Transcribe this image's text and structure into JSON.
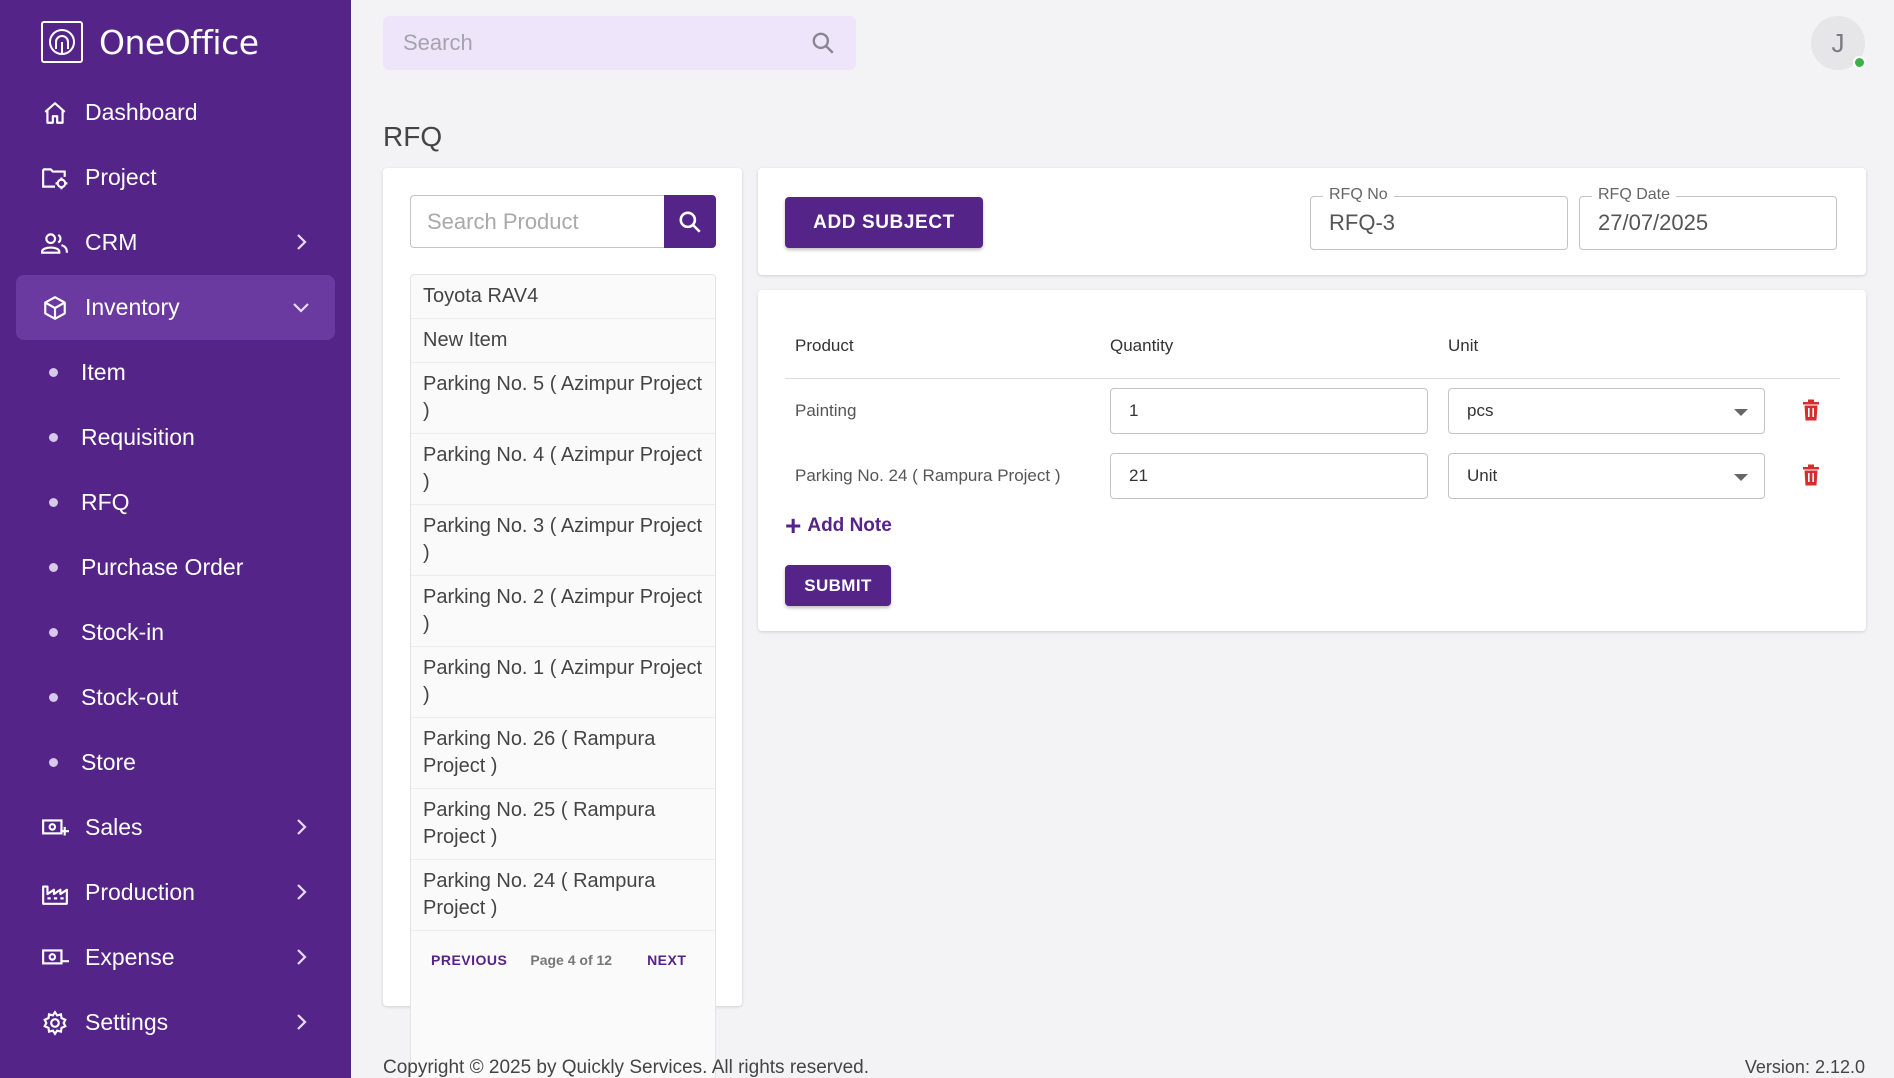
{
  "brand": {
    "name": "OneOffice"
  },
  "sidebar": {
    "items": [
      {
        "label": "Dashboard",
        "icon": "home-icon"
      },
      {
        "label": "Project",
        "icon": "folder-gear-icon"
      },
      {
        "label": "CRM",
        "icon": "users-icon"
      },
      {
        "label": "Inventory",
        "icon": "box-icon"
      },
      {
        "label": "Sales",
        "icon": "money-plus-icon"
      },
      {
        "label": "Production",
        "icon": "factory-icon"
      },
      {
        "label": "Expense",
        "icon": "money-minus-icon"
      },
      {
        "label": "Settings",
        "icon": "gear-icon"
      }
    ],
    "inventory_sub": [
      "Item",
      "Requisition",
      "RFQ",
      "Purchase Order",
      "Stock-in",
      "Stock-out",
      "Store"
    ]
  },
  "topbar": {
    "search_placeholder": "Search",
    "avatar_initial": "J"
  },
  "page": {
    "title": "RFQ"
  },
  "product_panel": {
    "search_placeholder": "Search Product",
    "items": [
      "Toyota RAV4",
      "New Item",
      "Parking No. 5 ( Azimpur Project )",
      "Parking No. 4 ( Azimpur Project )",
      "Parking No. 3 ( Azimpur Project )",
      "Parking No. 2 ( Azimpur Project )",
      "Parking No. 1 ( Azimpur Project )",
      "Parking No. 26 ( Rampura Project )",
      "Parking No. 25 ( Rampura Project )",
      "Parking No. 24 ( Rampura Project )"
    ],
    "pagination": {
      "previous": "PREVIOUS",
      "info": "Page 4 of 12",
      "next": "NEXT"
    }
  },
  "header": {
    "add_subject": "ADD SUBJECT",
    "rfq_no_label": "RFQ No",
    "rfq_no_value": "RFQ-3",
    "rfq_date_label": "RFQ Date",
    "rfq_date_value": "27/07/2025"
  },
  "items_table": {
    "columns": [
      "Product",
      "Quantity",
      "Unit"
    ],
    "rows": [
      {
        "product": "Painting",
        "quantity": "1",
        "unit": "pcs"
      },
      {
        "product": "Parking No. 24 ( Rampura Project )",
        "quantity": "21",
        "unit": "Unit"
      }
    ],
    "add_note": "Add Note",
    "submit": "SUBMIT"
  },
  "footer": {
    "copyright": "Copyright © 2025 by Quickly Services. All rights reserved.",
    "version": "Version: 2.12.0"
  },
  "colors": {
    "primary": "#552489",
    "danger": "#d32f2f",
    "online": "#3cb04a"
  }
}
